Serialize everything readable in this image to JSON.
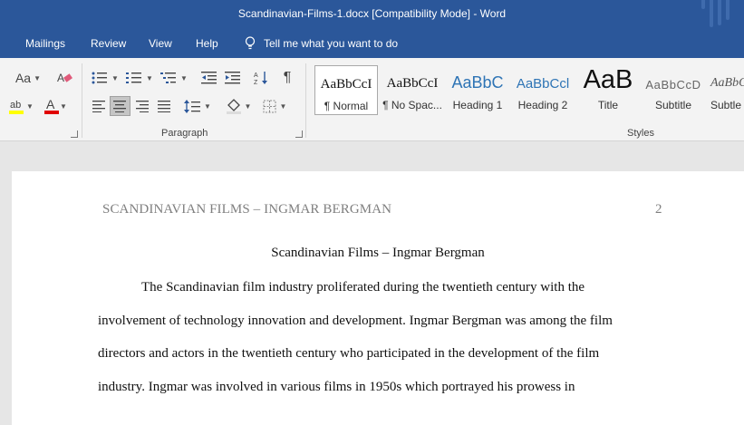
{
  "window": {
    "title": "Scandinavian-Films-1.docx [Compatibility Mode]  -  Word"
  },
  "tabs": [
    "Mailings",
    "Review",
    "View",
    "Help"
  ],
  "tell_me": "Tell me what you want to do",
  "font_group": {
    "font_size_label": "Aa"
  },
  "paragraph_group": {
    "label": "Paragraph",
    "pilcrow": "¶"
  },
  "styles_group": {
    "label": "Styles",
    "items": [
      {
        "preview": "AaBbCcI",
        "name": "¶ Normal"
      },
      {
        "preview": "AaBbCcI",
        "name": "¶ No Spac..."
      },
      {
        "preview": "AaBbC",
        "name": "Heading 1"
      },
      {
        "preview": "AaBbCcl",
        "name": "Heading 2"
      },
      {
        "preview": "AaB",
        "name": "Title"
      },
      {
        "preview": "AaBbCcD",
        "name": "Subtitle"
      },
      {
        "preview": "AaBbCo",
        "name": "Subtle"
      }
    ]
  },
  "document": {
    "header_left": "SCANDINAVIAN FILMS – INGMAR BERGMAN",
    "page_number": "2",
    "title": "Scandinavian Films – Ingmar Bergman",
    "lines": [
      "The Scandinavian film industry proliferated during the twentieth century with the",
      "involvement of technology innovation and development. Ingmar Bergman was among the film",
      "directors and actors in the twentieth century who participated in the development of the film",
      "industry. Ingmar was involved in various films in 1950s which portrayed his prowess in"
    ]
  },
  "colors": {
    "title_bar": "#2b579a",
    "ribbon": "#f3f3f3",
    "highlight": "#ffff00",
    "font_color": "#e00000"
  }
}
